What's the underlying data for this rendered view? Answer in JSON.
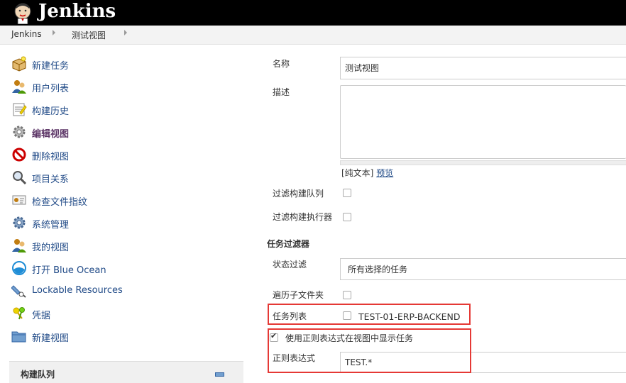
{
  "header": {
    "brand": "Jenkins"
  },
  "breadcrumb": {
    "items": [
      "Jenkins",
      "测试视图"
    ]
  },
  "sidebar": {
    "items": [
      {
        "label": "新建任务",
        "icon": "new-package-icon"
      },
      {
        "label": "用户列表",
        "icon": "user-icon"
      },
      {
        "label": "构建历史",
        "icon": "notepad-icon"
      },
      {
        "label": "编辑视图",
        "icon": "gear-icon"
      },
      {
        "label": "删除视图",
        "icon": "no-entry-icon"
      },
      {
        "label": "项目关系",
        "icon": "magnifier-icon"
      },
      {
        "label": "检查文件指纹",
        "icon": "fingerprint-icon"
      },
      {
        "label": "系统管理",
        "icon": "gear-icon"
      },
      {
        "label": "我的视图",
        "icon": "user-icon"
      },
      {
        "label": "打开 Blue Ocean",
        "icon": "blue-ocean-icon"
      },
      {
        "label": "Lockable Resources",
        "icon": "plug-icon"
      },
      {
        "label": "凭据",
        "icon": "keys-icon"
      },
      {
        "label": "新建视图",
        "icon": "folder-icon"
      }
    ],
    "queue_title": "构建队列"
  },
  "form": {
    "name_label": "名称",
    "name_value": "测试视图",
    "desc_label": "描述",
    "plain_text": "[纯文本]",
    "preview": "预览",
    "filter_queue": "过滤构建队列",
    "filter_executors": "过滤构建执行器",
    "job_filters_heading": "任务过滤器",
    "status_filter_label": "状态过滤",
    "status_filter_value": "所有选择的任务",
    "recurse_label": "遍历子文件夹",
    "jobs_label": "任务列表",
    "job_item": "TEST-01-ERP-BACKEND",
    "regex_check_label": "使用正则表达式在视图中显示任务",
    "regex_label": "正则表达式",
    "regex_value": "TEST.*"
  },
  "colors": {
    "link": "#204a87",
    "highlight": "#e53935",
    "header_bg": "#000000"
  }
}
